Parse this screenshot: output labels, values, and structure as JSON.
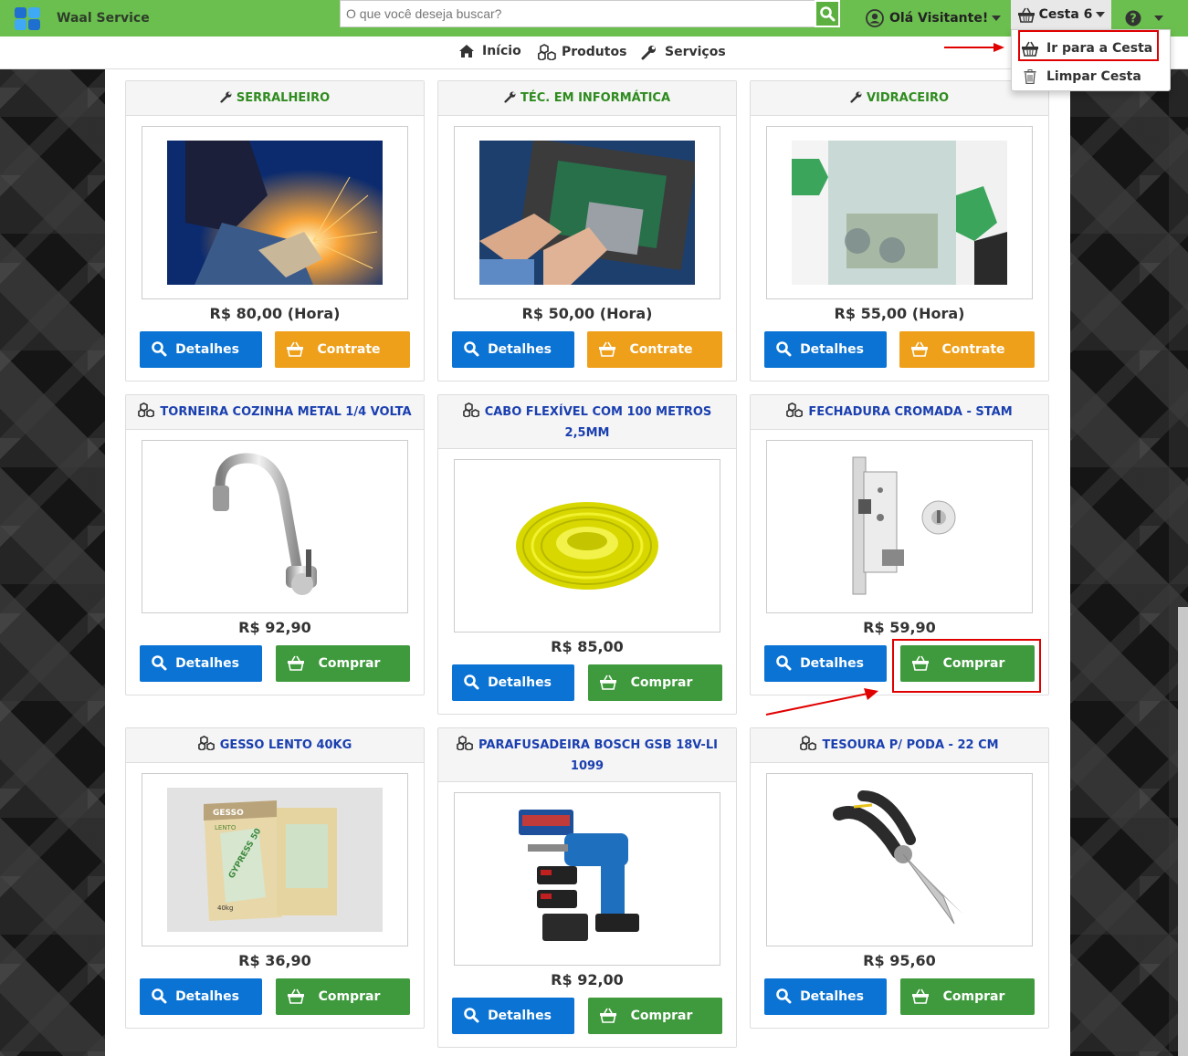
{
  "navbar": {
    "brand": "Waal Service",
    "search_placeholder": "O que você deseja buscar?",
    "user_label": "Olá Visitante!",
    "cesta_label": "Cesta 6"
  },
  "cesta_dropdown": {
    "items": [
      {
        "label": "Ir para a Cesta",
        "icon": "basket-icon"
      },
      {
        "label": "Limpar Cesta",
        "icon": "trash-icon"
      }
    ]
  },
  "subnav": {
    "items": [
      {
        "label": "Início",
        "icon": "home-icon"
      },
      {
        "label": "Produtos",
        "icon": "cubes-icon"
      },
      {
        "label": "Serviços",
        "icon": "wrench-icon"
      }
    ]
  },
  "colors": {
    "navbar": "#6bbf4e",
    "service_title": "#2e8b1e",
    "product_title": "#1a3fb0",
    "details_button": "#0a73d4",
    "contract_button": "#efa01a",
    "buy_button": "#3e9a3c",
    "highlight": "#e00000"
  },
  "cards": [
    {
      "type": "service",
      "title": "SERRALHEIRO",
      "price": "R$ 80,00 (Hora)",
      "details": "Detalhes",
      "action": "Contrate",
      "image": "welder-photo"
    },
    {
      "type": "service",
      "title": "TÉC. EM INFORMÁTICA",
      "price": "R$ 50,00 (Hora)",
      "details": "Detalhes",
      "action": "Contrate",
      "image": "laptop-repair-photo"
    },
    {
      "type": "service",
      "title": "VIDRACEIRO",
      "price": "R$ 55,00 (Hora)",
      "details": "Detalhes",
      "action": "Contrate",
      "image": "glazier-photo"
    },
    {
      "type": "product",
      "title": "TORNEIRA COZINHA METAL 1/4 VOLTA",
      "price": "R$ 92,90",
      "details": "Detalhes",
      "action": "Comprar",
      "image": "faucet-photo"
    },
    {
      "type": "product",
      "title": "CABO FLEXÍVEL COM 100 METROS 2,5MM",
      "price": "R$ 85,00",
      "details": "Detalhes",
      "action": "Comprar",
      "image": "yellow-cable-photo"
    },
    {
      "type": "product",
      "title": "FECHADURA CROMADA - STAM",
      "price": "R$ 59,90",
      "details": "Detalhes",
      "action": "Comprar",
      "image": "door-lock-photo"
    },
    {
      "type": "product",
      "title": "GESSO LENTO 40KG",
      "price": "R$ 36,90",
      "details": "Detalhes",
      "action": "Comprar",
      "image": "plaster-bag-photo"
    },
    {
      "type": "product",
      "title": "PARAFUSADEIRA BOSCH GSB 18V-LI 1099",
      "price": "R$ 92,00",
      "details": "Detalhes",
      "action": "Comprar",
      "image": "drill-photo"
    },
    {
      "type": "product",
      "title": "TESOURA P/ PODA - 22 CM",
      "price": "R$ 95,60",
      "details": "Detalhes",
      "action": "Comprar",
      "image": "pruning-shears-photo"
    }
  ],
  "gesso_bag": {
    "brand": "GESSO",
    "sub": "LENTO",
    "name": "GYPRESS 50",
    "weight": "40kg"
  }
}
